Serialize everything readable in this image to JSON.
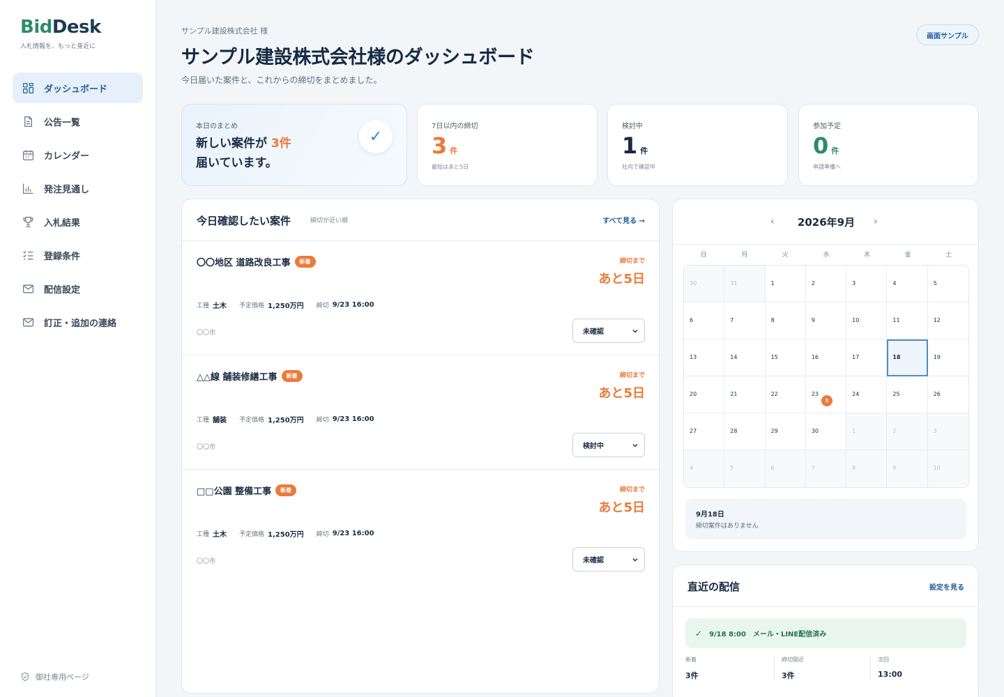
{
  "brand": {
    "logo_bid": "Bid",
    "logo_desk": "Desk",
    "tagline": "入札情報を、もっと身近に"
  },
  "sidebar": {
    "items": [
      {
        "label": "ダッシュボード",
        "icon": "dashboard-icon",
        "active": true
      },
      {
        "label": "公告一覧",
        "icon": "document-icon"
      },
      {
        "label": "カレンダー",
        "icon": "calendar-icon"
      },
      {
        "label": "発注見通し",
        "icon": "bar-chart-icon"
      },
      {
        "label": "入札結果",
        "icon": "trophy-icon"
      },
      {
        "label": "登録条件",
        "icon": "checklist-icon"
      },
      {
        "label": "配信設定",
        "icon": "mail-icon"
      },
      {
        "label": "訂正・追加の連絡",
        "icon": "mail-icon"
      }
    ],
    "footer": "御社専用ページ"
  },
  "header": {
    "breadcrumb": "サンプル建設株式会社 様",
    "title": "サンプル建設株式会社様のダッシュボード",
    "subtitle": "今日届いた案件と、これからの締切をまとめました。",
    "sample_button": "画面サンプル"
  },
  "summary": {
    "label": "本日のまとめ",
    "text_before": "新しい案件が",
    "count": "3件",
    "text_after": "届いています。"
  },
  "stats": [
    {
      "label": "7日以内の締切",
      "value": "3",
      "unit": "件",
      "note": "最短はあと5日",
      "color": "#ec7a3a"
    },
    {
      "label": "検討中",
      "value": "1",
      "unit": "件",
      "note": "社内で確認中",
      "color": "#162a42"
    },
    {
      "label": "参加予定",
      "value": "0",
      "unit": "件",
      "note": "申請準備へ",
      "color": "#2e8a6c"
    }
  ],
  "cases": {
    "title": "今日確認したい案件",
    "sort": "締切が近い順",
    "see_all": "すべて見る →",
    "items": [
      {
        "name": "〇〇地区 道路改良工事",
        "badge": "新着",
        "deadline_label": "締切まで",
        "deadline": "あと5日",
        "type_label": "工種",
        "type": "土木",
        "price_label": "予定価格",
        "price": "1,250万円",
        "due_label": "締切",
        "due": "9/23 16:00",
        "location": "〇〇市",
        "status": "未確認"
      },
      {
        "name": "△△線 舗装修繕工事",
        "badge": "新着",
        "deadline_label": "締切まで",
        "deadline": "あと5日",
        "type_label": "工種",
        "type": "舗装",
        "price_label": "予定価格",
        "price": "1,250万円",
        "due_label": "締切",
        "due": "9/23 16:00",
        "location": "〇〇市",
        "status": "検討中"
      },
      {
        "name": "□□公園 整備工事",
        "badge": "新着",
        "deadline_label": "締切まで",
        "deadline": "あと5日",
        "type_label": "工種",
        "type": "土木",
        "price_label": "予定価格",
        "price": "1,250万円",
        "due_label": "締切",
        "due": "9/23 16:00",
        "location": "〇〇市",
        "status": "未確認"
      }
    ]
  },
  "calendar": {
    "month": "2026年9月",
    "prev": "‹",
    "next": "›",
    "weekdays": [
      "日",
      "月",
      "火",
      "水",
      "木",
      "金",
      "土"
    ],
    "days": [
      {
        "d": "30",
        "muted": true
      },
      {
        "d": "31",
        "muted": true
      },
      {
        "d": "1"
      },
      {
        "d": "2"
      },
      {
        "d": "3"
      },
      {
        "d": "4"
      },
      {
        "d": "5"
      },
      {
        "d": "6"
      },
      {
        "d": "7"
      },
      {
        "d": "8"
      },
      {
        "d": "9"
      },
      {
        "d": "10"
      },
      {
        "d": "11"
      },
      {
        "d": "12"
      },
      {
        "d": "13"
      },
      {
        "d": "14"
      },
      {
        "d": "15"
      },
      {
        "d": "16"
      },
      {
        "d": "17"
      },
      {
        "d": "18",
        "today": true
      },
      {
        "d": "19"
      },
      {
        "d": "20"
      },
      {
        "d": "21"
      },
      {
        "d": "22"
      },
      {
        "d": "23",
        "count": "3"
      },
      {
        "d": "24"
      },
      {
        "d": "25"
      },
      {
        "d": "26"
      },
      {
        "d": "27"
      },
      {
        "d": "28"
      },
      {
        "d": "29"
      },
      {
        "d": "30"
      },
      {
        "d": "1",
        "muted": true
      },
      {
        "d": "2",
        "muted": true
      },
      {
        "d": "3",
        "muted": true
      },
      {
        "d": "4",
        "muted": true
      },
      {
        "d": "5",
        "muted": true
      },
      {
        "d": "6",
        "muted": true
      },
      {
        "d": "7",
        "muted": true
      },
      {
        "d": "8",
        "muted": true
      },
      {
        "d": "9",
        "muted": true
      },
      {
        "d": "10",
        "muted": true
      }
    ],
    "detail_date": "9月18日",
    "detail_text": "締切案件はありません"
  },
  "delivery": {
    "title": "直近の配信",
    "link": "設定を見る",
    "status_check": "✓",
    "status": "9/18 8:00　メール・LINE配信済み",
    "stats": [
      {
        "label": "新着",
        "value": "3件"
      },
      {
        "label": "締切間近",
        "value": "3件"
      },
      {
        "label": "次回",
        "value": "13:00"
      }
    ]
  }
}
